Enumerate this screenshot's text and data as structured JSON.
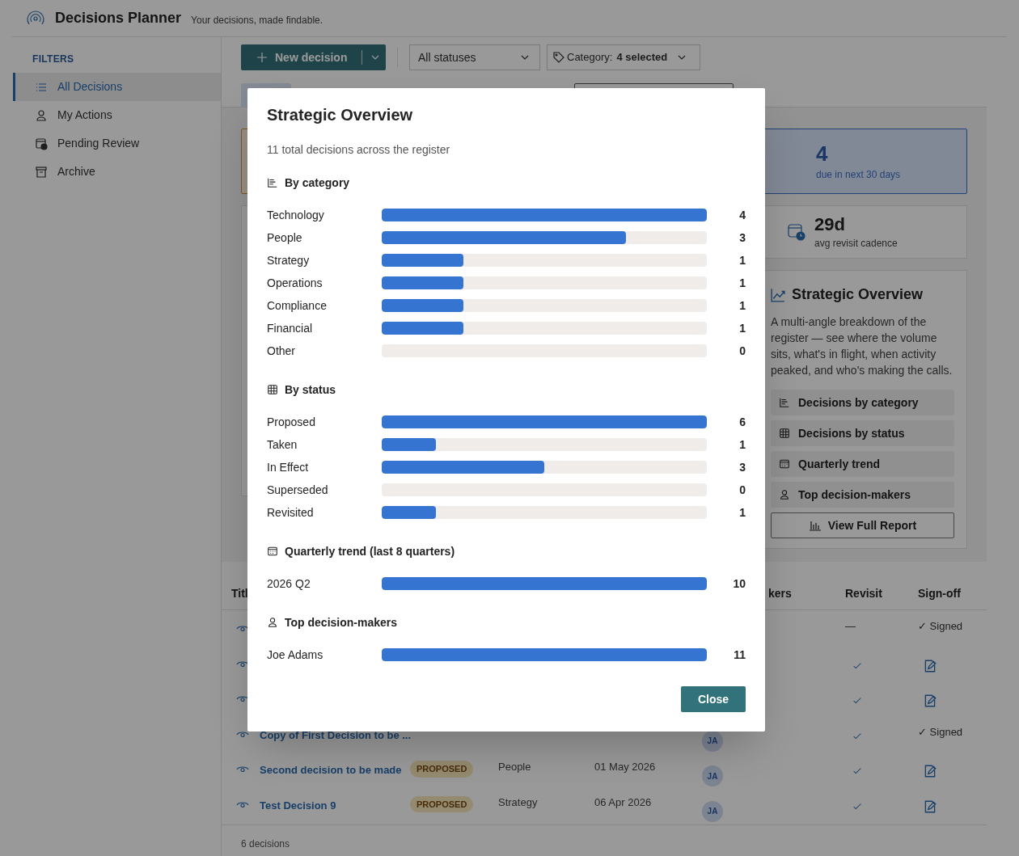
{
  "app": {
    "title": "Decisions Planner",
    "tagline": "Your decisions, made findable."
  },
  "sidebar": {
    "heading": "FILTERS",
    "items": [
      {
        "label": "All Decisions",
        "kind": "list",
        "selected": true
      },
      {
        "label": "My Actions",
        "kind": "person",
        "selected": false
      },
      {
        "label": "Pending Review",
        "kind": "clock",
        "selected": false
      },
      {
        "label": "Archive",
        "kind": "archive",
        "selected": false
      }
    ]
  },
  "toolbar": {
    "new_button": "New decision",
    "status_filter": "All statuses",
    "category_filter": {
      "label": "Category:",
      "value": "4 selected"
    }
  },
  "stats": [
    {
      "value": "4",
      "label": "due in next 30 days",
      "kind": "highlight"
    },
    {
      "value": "29d",
      "label": "avg revisit cadence",
      "kind": "plain"
    }
  ],
  "overview_panel": {
    "title": "Strategic Overview",
    "description": "A multi-angle breakdown of the register — see where the volume sits, what's in flight, when activity peaked, and who's making the calls.",
    "links": [
      {
        "label": "Decisions by category",
        "kind": "category"
      },
      {
        "label": "Decisions by status",
        "kind": "status"
      },
      {
        "label": "Quarterly trend",
        "kind": "trend"
      },
      {
        "label": "Top decision-makers",
        "kind": "people"
      }
    ],
    "report_button": "View Full Report"
  },
  "table": {
    "columns": [
      "Titl",
      "kers",
      "Revisit",
      "Sign-off"
    ],
    "rows": [
      {
        "reviewed": false,
        "revisit": "—",
        "signed": true,
        "signoff": "✓ Signed"
      },
      {
        "reviewed": true,
        "signed": false
      },
      {
        "reviewed": true,
        "signed": false
      },
      {
        "title": "Copy of First Decision to be ...",
        "initials": "JA",
        "reviewed": true,
        "signed": true,
        "signoff": "✓ Signed"
      },
      {
        "title": "Second decision to be made",
        "status": "PROPOSED",
        "category": "People",
        "date": "01 May 2026",
        "initials": "JA",
        "reviewed": true,
        "signed": false
      },
      {
        "title": "Test Decision 9",
        "status": "PROPOSED",
        "category": "Strategy",
        "date": "06 Apr 2026",
        "initials": "JA",
        "reviewed": true,
        "signed": false
      }
    ],
    "footer": "6 decisions"
  },
  "modal": {
    "title": "Strategic Overview",
    "subtitle": "11 total decisions across the register",
    "sections": [
      {
        "heading": "By category",
        "kind": "category",
        "items": [
          {
            "label": "Technology",
            "level": 1,
            "count": "4"
          },
          {
            "label": "People",
            "level": 0.75,
            "count": "3"
          },
          {
            "label": "Strategy",
            "level": 0.25,
            "count": "1"
          },
          {
            "label": "Operations",
            "level": 0.25,
            "count": "1"
          },
          {
            "label": "Compliance",
            "level": 0.25,
            "count": "1"
          },
          {
            "label": "Financial",
            "level": 0.25,
            "count": "1"
          },
          {
            "label": "Other",
            "level": 0,
            "count": "0"
          }
        ]
      },
      {
        "heading": "By status",
        "kind": "status",
        "items": [
          {
            "label": "Proposed",
            "level": 1,
            "count": "6"
          },
          {
            "label": "Taken",
            "level": 0.1667,
            "count": "1"
          },
          {
            "label": "In Effect",
            "level": 0.5,
            "count": "3"
          },
          {
            "label": "Superseded",
            "level": 0,
            "count": "0"
          },
          {
            "label": "Revisited",
            "level": 0.1667,
            "count": "1"
          }
        ]
      },
      {
        "heading": "Quarterly trend (last 8 quarters)",
        "kind": "trend",
        "items": [
          {
            "label": "2026 Q2",
            "level": 1,
            "count": "10"
          }
        ]
      },
      {
        "heading": "Top decision-makers",
        "kind": "people",
        "items": [
          {
            "label": "Joe Adams",
            "level": 1,
            "count": "11"
          }
        ]
      }
    ],
    "close_button": "Close"
  }
}
